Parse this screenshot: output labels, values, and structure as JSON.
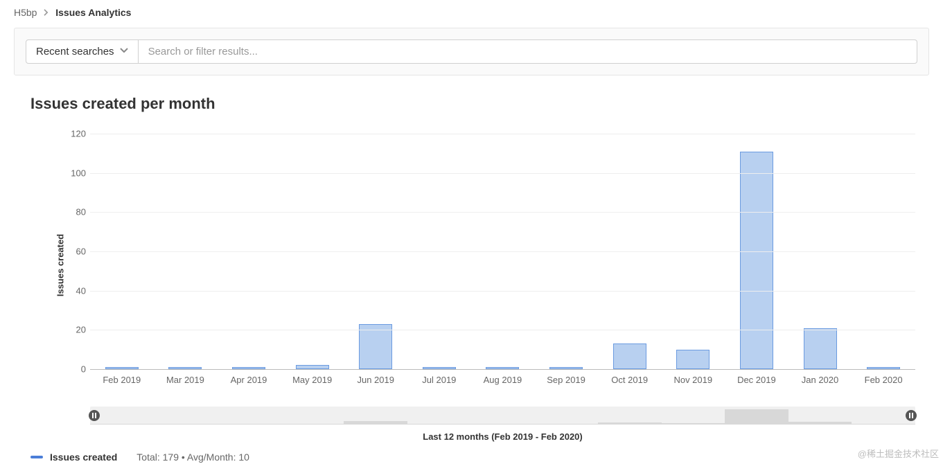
{
  "breadcrumb": {
    "parent": "H5bp",
    "current": "Issues Analytics"
  },
  "search": {
    "recent_label": "Recent searches",
    "placeholder": "Search or filter results..."
  },
  "chart": {
    "title": "Issues created per month",
    "ylabel": "Issues created",
    "xlabel": "Last 12 months (Feb 2019 - Feb 2020)"
  },
  "chart_data": {
    "type": "bar",
    "categories": [
      "Feb 2019",
      "Mar 2019",
      "Apr 2019",
      "May 2019",
      "Jun 2019",
      "Jul 2019",
      "Aug 2019",
      "Sep 2019",
      "Oct 2019",
      "Nov 2019",
      "Dec 2019",
      "Jan 2020",
      "Feb 2020"
    ],
    "values": [
      1,
      1,
      1,
      2,
      23,
      1,
      1,
      1,
      13,
      10,
      111,
      21,
      1
    ],
    "title": "Issues created per month",
    "xlabel": "Last 12 months (Feb 2019 - Feb 2020)",
    "ylabel": "Issues created",
    "ylim": [
      0,
      120
    ],
    "yticks": [
      0,
      20,
      40,
      60,
      80,
      100,
      120
    ],
    "legend": [
      "Issues created"
    ]
  },
  "legend": {
    "series_name": "Issues created",
    "stats": "Total: 179 • Avg/Month: 10"
  },
  "watermark": "@稀土掘金技术社区"
}
